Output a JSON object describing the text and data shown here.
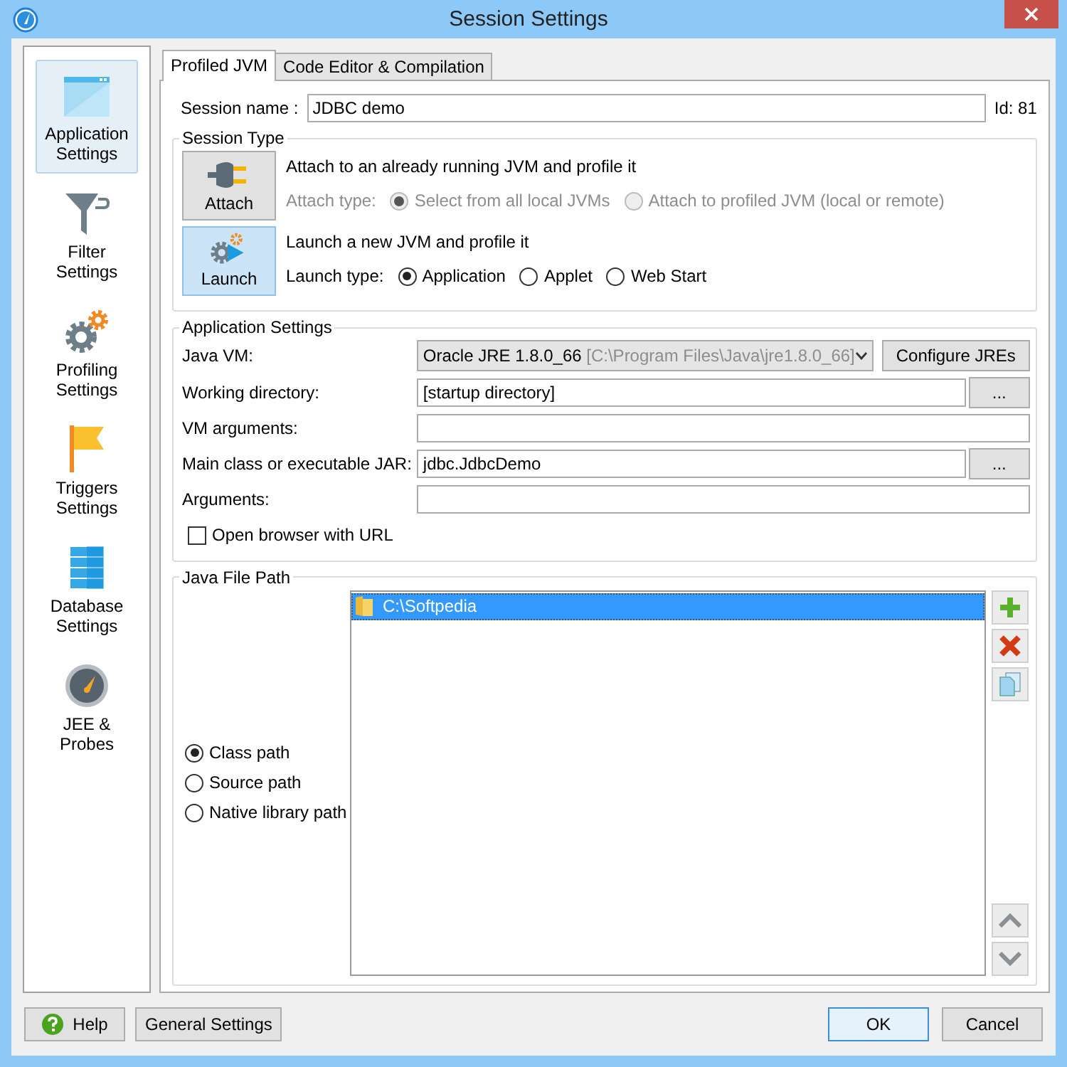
{
  "window": {
    "title": "Session Settings"
  },
  "sidebar": {
    "items": [
      {
        "label": "Application Settings",
        "kind": "window",
        "selected": true
      },
      {
        "label": "Filter Settings",
        "kind": "funnel",
        "selected": false
      },
      {
        "label": "Profiling Settings",
        "kind": "gears",
        "selected": false
      },
      {
        "label": "Triggers Settings",
        "kind": "flag",
        "selected": false
      },
      {
        "label": "Database Settings",
        "kind": "database",
        "selected": false
      },
      {
        "label": "JEE & Probes",
        "kind": "gauge",
        "selected": false
      }
    ]
  },
  "tabs": [
    {
      "label": "Profiled JVM",
      "selected": true
    },
    {
      "label": "Code Editor & Compilation",
      "selected": false
    }
  ],
  "session_name": {
    "label": "Session name :",
    "value": "JDBC demo",
    "id": "Id: 81"
  },
  "session_type": {
    "title": "Session Type",
    "options": [
      {
        "button": "Attach",
        "kind": "attach",
        "selected": false,
        "disabled": true,
        "description": "Attach to an already running JVM and profile it",
        "type_label": "Attach type:",
        "choices": [
          {
            "label": "Select from all local JVMs",
            "selected": true
          },
          {
            "label": "Attach to profiled JVM (local or remote)",
            "selected": false
          }
        ]
      },
      {
        "button": "Launch",
        "kind": "launch",
        "selected": true,
        "disabled": false,
        "description": "Launch a new JVM and profile it",
        "type_label": "Launch type:",
        "choices": [
          {
            "label": "Application",
            "selected": true
          },
          {
            "label": "Applet",
            "selected": false
          },
          {
            "label": "Web Start",
            "selected": false
          }
        ]
      }
    ]
  },
  "application_settings": {
    "title": "Application Settings",
    "java_vm": {
      "label": "Java VM:",
      "value": "Oracle JRE 1.8.0_66",
      "detail": "[C:\\Program Files\\Java\\jre1.8.0_66]",
      "button": "Configure JREs"
    },
    "fields": [
      {
        "label": "Working directory:",
        "value": "[startup directory]",
        "browse": "..."
      },
      {
        "label": "VM arguments:"
      },
      {
        "label": "Main class or executable JAR:",
        "value": "jdbc.JdbcDemo",
        "browse": "..."
      },
      {
        "label": "Arguments:"
      }
    ],
    "open_browser": {
      "label": "Open browser with URL",
      "checked": false
    }
  },
  "java_file_path": {
    "title": "Java File Path",
    "path_types": [
      {
        "label": "Class path",
        "selected": true
      },
      {
        "label": "Source path",
        "selected": false
      },
      {
        "label": "Native library path",
        "selected": false
      }
    ],
    "entries": [
      {
        "path": "C:\\Softpedia",
        "selected": true
      }
    ],
    "side_buttons": [
      {
        "kind": "add"
      },
      {
        "kind": "remove"
      },
      {
        "kind": "copy"
      },
      {
        "kind": "up"
      },
      {
        "kind": "down"
      }
    ]
  },
  "footer": {
    "buttons": [
      {
        "label": "Help",
        "kind": "help"
      },
      {
        "label": "General Settings",
        "kind": "plain"
      },
      {
        "label": "OK",
        "kind": "default"
      },
      {
        "label": "Cancel",
        "kind": "plain"
      }
    ]
  }
}
